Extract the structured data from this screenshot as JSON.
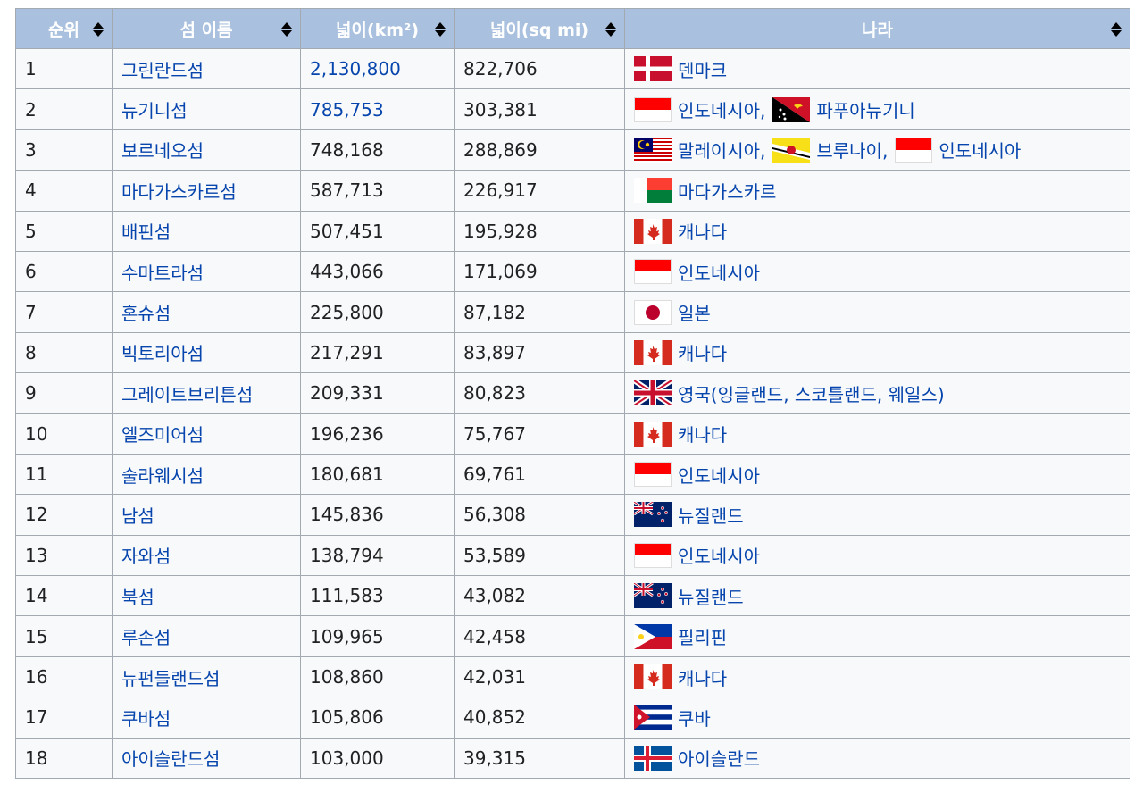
{
  "headers": [
    {
      "label": "순위"
    },
    {
      "label": "섬 이름"
    },
    {
      "label": "넓이(km²)"
    },
    {
      "label": "넓이(sq mi)"
    },
    {
      "label": "나라"
    }
  ],
  "rows": [
    {
      "rank": "1",
      "name": "그린란드섬",
      "km2": "2,130,800",
      "km2_link": true,
      "sqmi": "822,706",
      "countries": [
        {
          "flag": "denmark-flag",
          "label": "덴마크"
        }
      ]
    },
    {
      "rank": "2",
      "name": "뉴기니섬",
      "km2": "785,753",
      "km2_link": true,
      "sqmi": "303,381",
      "countries": [
        {
          "flag": "indonesia-flag",
          "label": "인도네시아,"
        },
        {
          "flag": "papua-new-guinea-flag",
          "label": "파푸아뉴기니"
        }
      ]
    },
    {
      "rank": "3",
      "name": "보르네오섬",
      "km2": "748,168",
      "sqmi": "288,869",
      "countries": [
        {
          "flag": "malaysia-flag",
          "label": "말레이시아,"
        },
        {
          "flag": "brunei-flag",
          "label": "브루나이,"
        },
        {
          "flag": "indonesia-flag",
          "label": "인도네시아"
        }
      ]
    },
    {
      "rank": "4",
      "name": "마다가스카르섬",
      "km2": "587,713",
      "sqmi": "226,917",
      "countries": [
        {
          "flag": "madagascar-flag",
          "label": "마다가스카르"
        }
      ]
    },
    {
      "rank": "5",
      "name": "배핀섬",
      "km2": "507,451",
      "sqmi": "195,928",
      "countries": [
        {
          "flag": "canada-flag",
          "label": "캐나다"
        }
      ]
    },
    {
      "rank": "6",
      "name": "수마트라섬",
      "km2": "443,066",
      "sqmi": "171,069",
      "countries": [
        {
          "flag": "indonesia-flag",
          "label": "인도네시아"
        }
      ]
    },
    {
      "rank": "7",
      "name": "혼슈섬",
      "km2": "225,800",
      "sqmi": "87,182",
      "countries": [
        {
          "flag": "japan-flag",
          "label": "일본"
        }
      ]
    },
    {
      "rank": "8",
      "name": "빅토리아섬",
      "km2": "217,291",
      "sqmi": "83,897",
      "countries": [
        {
          "flag": "canada-flag",
          "label": "캐나다"
        }
      ]
    },
    {
      "rank": "9",
      "name": "그레이트브리튼섬",
      "km2": "209,331",
      "sqmi": "80,823",
      "countries": [
        {
          "flag": "uk-flag",
          "label": "영국(잉글랜드, 스코틀랜드, 웨일스)"
        }
      ]
    },
    {
      "rank": "10",
      "name": "엘즈미어섬",
      "km2": "196,236",
      "sqmi": "75,767",
      "countries": [
        {
          "flag": "canada-flag",
          "label": "캐나다"
        }
      ]
    },
    {
      "rank": "11",
      "name": "술라웨시섬",
      "km2": "180,681",
      "sqmi": "69,761",
      "countries": [
        {
          "flag": "indonesia-flag",
          "label": "인도네시아"
        }
      ]
    },
    {
      "rank": "12",
      "name": "남섬",
      "km2": "145,836",
      "sqmi": "56,308",
      "countries": [
        {
          "flag": "new-zealand-flag",
          "label": "뉴질랜드"
        }
      ]
    },
    {
      "rank": "13",
      "name": "자와섬",
      "km2": "138,794",
      "sqmi": "53,589",
      "countries": [
        {
          "flag": "indonesia-flag",
          "label": "인도네시아"
        }
      ]
    },
    {
      "rank": "14",
      "name": "북섬",
      "km2": "111,583",
      "sqmi": "43,082",
      "countries": [
        {
          "flag": "new-zealand-flag",
          "label": "뉴질랜드"
        }
      ]
    },
    {
      "rank": "15",
      "name": "루손섬",
      "km2": "109,965",
      "sqmi": "42,458",
      "countries": [
        {
          "flag": "philippines-flag",
          "label": "필리핀"
        }
      ]
    },
    {
      "rank": "16",
      "name": "뉴펀들랜드섬",
      "km2": "108,860",
      "sqmi": "42,031",
      "countries": [
        {
          "flag": "canada-flag",
          "label": "캐나다"
        }
      ]
    },
    {
      "rank": "17",
      "name": "쿠바섬",
      "km2": "105,806",
      "sqmi": "40,852",
      "countries": [
        {
          "flag": "cuba-flag",
          "label": "쿠바"
        }
      ]
    },
    {
      "rank": "18",
      "name": "아이슬란드섬",
      "km2": "103,000",
      "sqmi": "39,315",
      "countries": [
        {
          "flag": "iceland-flag",
          "label": "아이슬란드"
        }
      ]
    }
  ]
}
